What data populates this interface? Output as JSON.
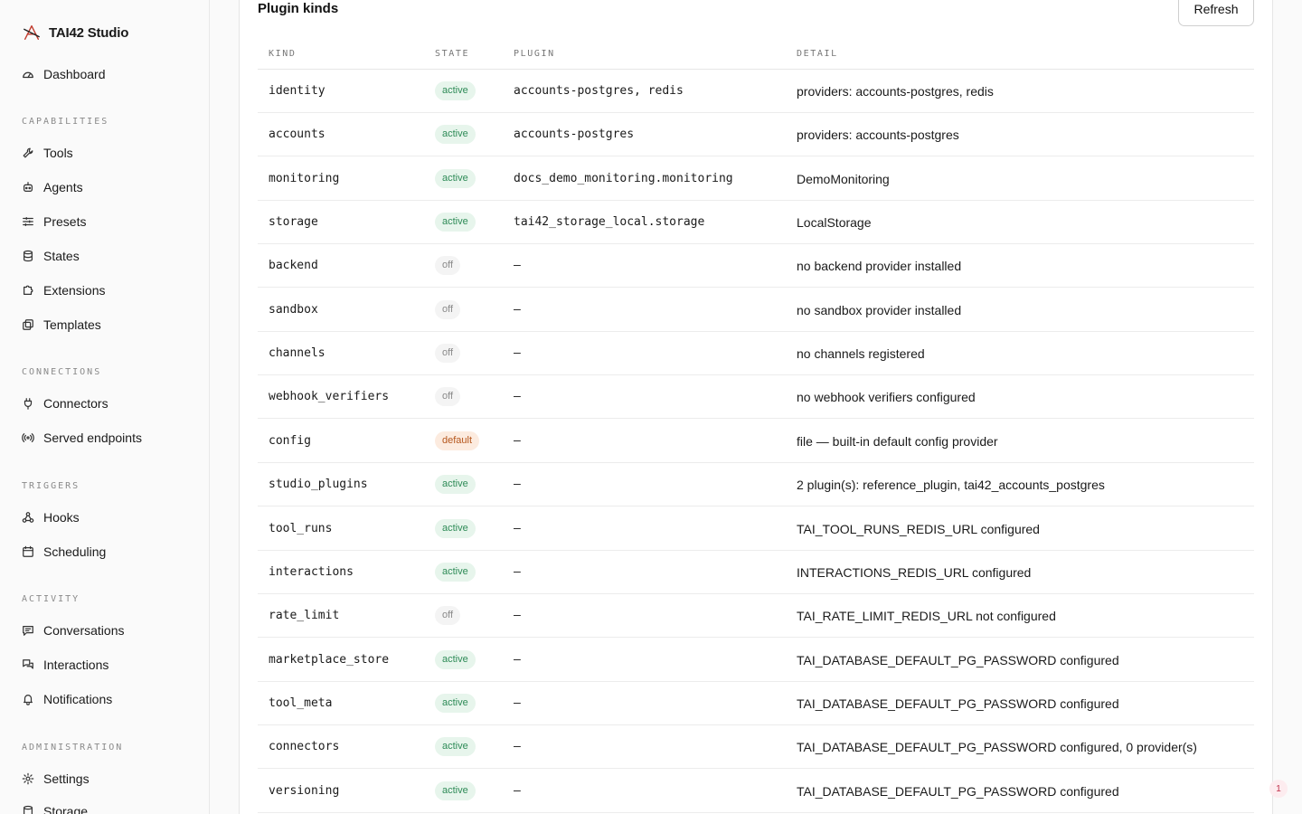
{
  "app": {
    "name": "TAI42 Studio",
    "notification_count": "1"
  },
  "sidebar": {
    "dashboard": "Dashboard",
    "sections": {
      "capabilities": "CAPABILITIES",
      "connections": "CONNECTIONS",
      "triggers": "TRIGGERS",
      "activity": "ACTIVITY",
      "administration": "ADMINISTRATION"
    },
    "items": {
      "tools": "Tools",
      "agents": "Agents",
      "presets": "Presets",
      "states": "States",
      "extensions": "Extensions",
      "templates": "Templates",
      "connectors": "Connectors",
      "served_endpoints": "Served endpoints",
      "hooks": "Hooks",
      "scheduling": "Scheduling",
      "conversations": "Conversations",
      "interactions": "Interactions",
      "notifications": "Notifications",
      "settings": "Settings",
      "storage": "Storage"
    }
  },
  "panel": {
    "title": "Plugin kinds",
    "refresh_label": "Refresh",
    "columns": [
      "KIND",
      "STATE",
      "PLUGIN",
      "DETAIL"
    ],
    "rows": [
      {
        "kind": "identity",
        "state": "active",
        "plugin": "accounts-postgres, redis",
        "detail": "providers: accounts-postgres, redis"
      },
      {
        "kind": "accounts",
        "state": "active",
        "plugin": "accounts-postgres",
        "detail": "providers: accounts-postgres"
      },
      {
        "kind": "monitoring",
        "state": "active",
        "plugin": "docs_demo_monitoring.monitoring",
        "detail": "DemoMonitoring"
      },
      {
        "kind": "storage",
        "state": "active",
        "plugin": "tai42_storage_local.storage",
        "detail": "LocalStorage"
      },
      {
        "kind": "backend",
        "state": "off",
        "plugin": "–",
        "detail": "no backend provider installed"
      },
      {
        "kind": "sandbox",
        "state": "off",
        "plugin": "–",
        "detail": "no sandbox provider installed"
      },
      {
        "kind": "channels",
        "state": "off",
        "plugin": "–",
        "detail": "no channels registered"
      },
      {
        "kind": "webhook_verifiers",
        "state": "off",
        "plugin": "–",
        "detail": "no webhook verifiers configured"
      },
      {
        "kind": "config",
        "state": "default",
        "plugin": "–",
        "detail": "file — built-in default config provider"
      },
      {
        "kind": "studio_plugins",
        "state": "active",
        "plugin": "–",
        "detail": "2 plugin(s): reference_plugin, tai42_accounts_postgres"
      },
      {
        "kind": "tool_runs",
        "state": "active",
        "plugin": "–",
        "detail": "TAI_TOOL_RUNS_REDIS_URL configured"
      },
      {
        "kind": "interactions",
        "state": "active",
        "plugin": "–",
        "detail": "INTERACTIONS_REDIS_URL configured"
      },
      {
        "kind": "rate_limit",
        "state": "off",
        "plugin": "–",
        "detail": "TAI_RATE_LIMIT_REDIS_URL not configured"
      },
      {
        "kind": "marketplace_store",
        "state": "active",
        "plugin": "–",
        "detail": "TAI_DATABASE_DEFAULT_PG_PASSWORD configured"
      },
      {
        "kind": "tool_meta",
        "state": "active",
        "plugin": "–",
        "detail": "TAI_DATABASE_DEFAULT_PG_PASSWORD configured"
      },
      {
        "kind": "connectors",
        "state": "active",
        "plugin": "–",
        "detail": "TAI_DATABASE_DEFAULT_PG_PASSWORD configured, 0 provider(s)"
      },
      {
        "kind": "versioning",
        "state": "active",
        "plugin": "–",
        "detail": "TAI_DATABASE_DEFAULT_PG_PASSWORD configured"
      }
    ]
  },
  "colors": {
    "active_badge_bg": "#e7f5ec",
    "active_badge_text": "#2e8b57",
    "off_badge_bg": "#f4f4f4",
    "off_badge_text": "#8a8a8a",
    "default_badge_bg": "#fcebdf",
    "default_badge_text": "#b5561c"
  }
}
